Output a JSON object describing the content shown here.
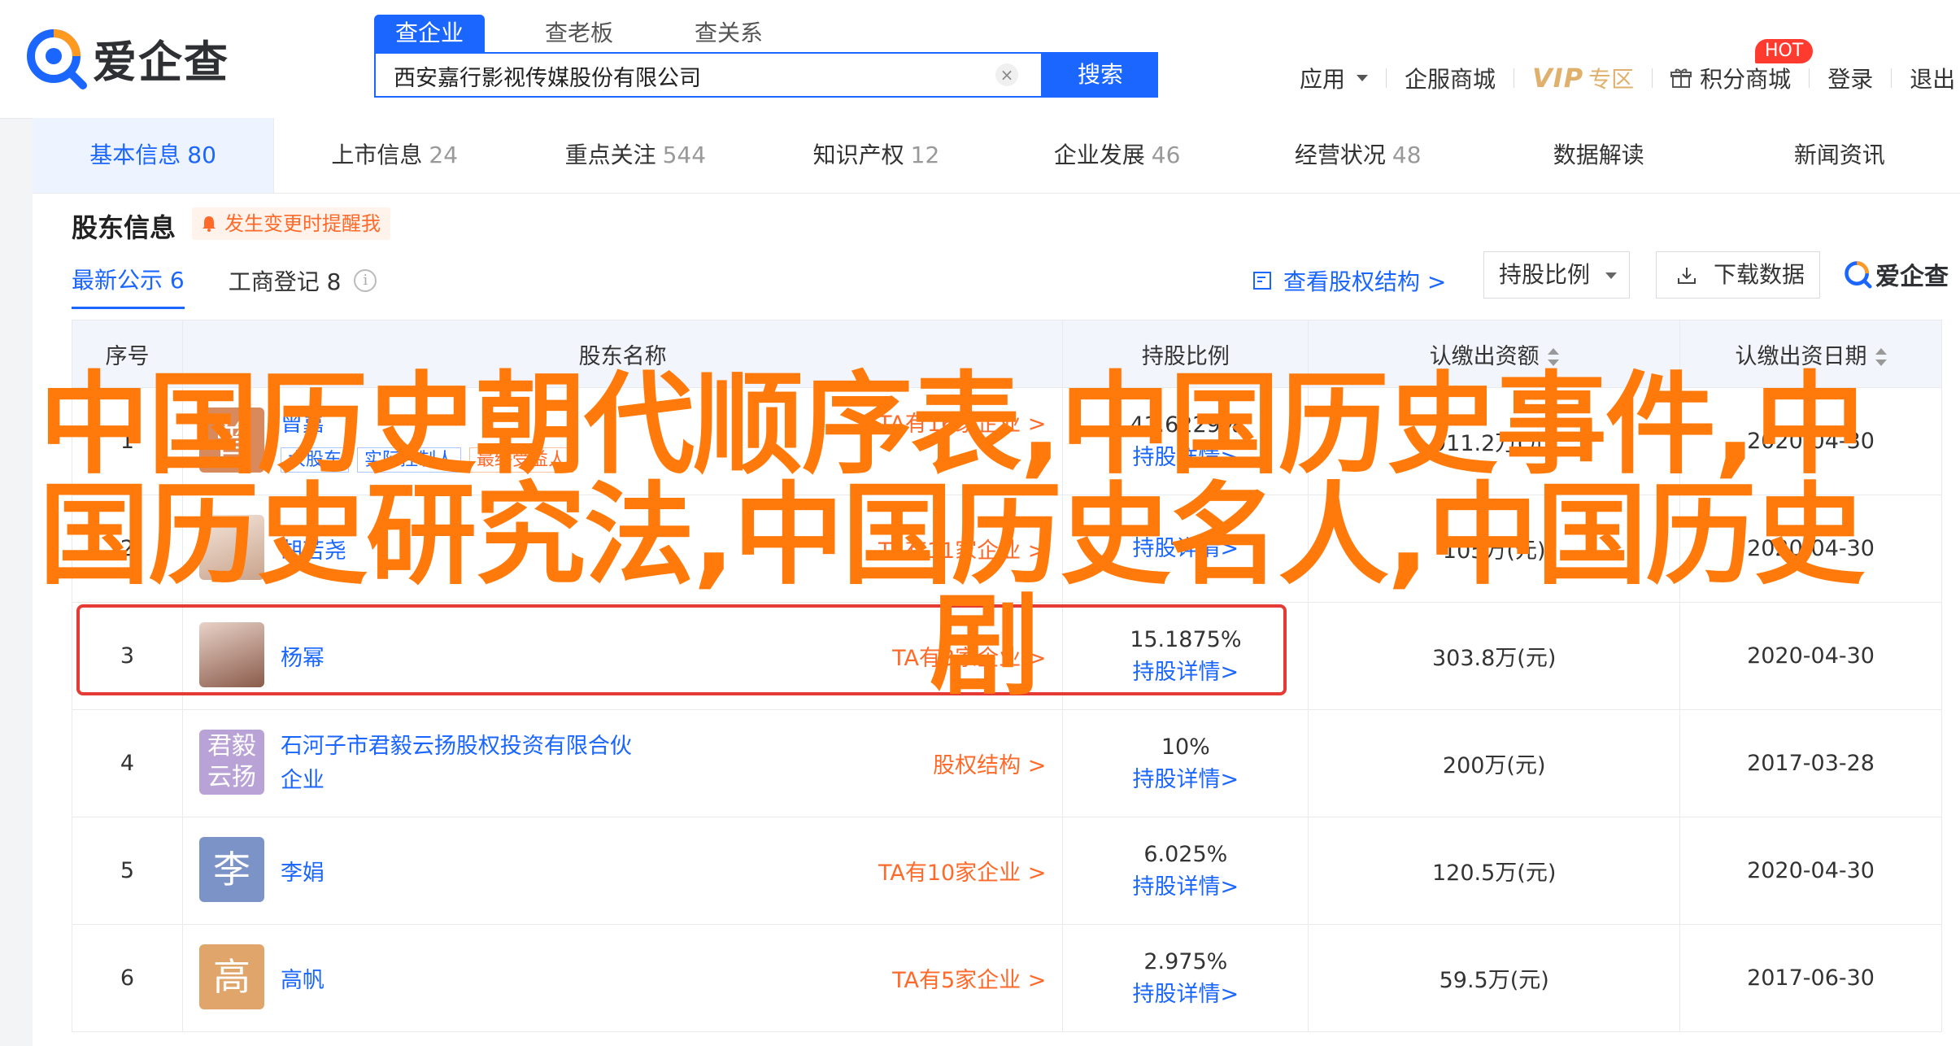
{
  "brand": {
    "name": "爱企查"
  },
  "search": {
    "tabs": [
      "查企业",
      "查老板",
      "查关系"
    ],
    "query": "西安嘉行影视传媒股份有限公司",
    "clear": "×",
    "button": "搜索"
  },
  "topnav": {
    "app": "应用",
    "service_mall": "企服商城",
    "vip": "VIP",
    "vip_zone": "专区",
    "points_mall": "积分商城",
    "hot": "HOT",
    "more": "登录",
    "exit": "退出"
  },
  "main_tabs": [
    {
      "label": "基本信息",
      "count": "80"
    },
    {
      "label": "上市信息",
      "count": "24"
    },
    {
      "label": "重点关注",
      "count": "544"
    },
    {
      "label": "知识产权",
      "count": "12"
    },
    {
      "label": "企业发展",
      "count": "46"
    },
    {
      "label": "经营状况",
      "count": "48"
    },
    {
      "label": "数据解读",
      "count": ""
    },
    {
      "label": "新闻资讯",
      "count": ""
    }
  ],
  "section": {
    "title": "股东信息",
    "notify": "发生变更时提醒我",
    "subtabs": [
      "最新公示 6",
      "工商登记 8"
    ],
    "equity_link": "查看股权结构 >",
    "ratio_dropdown": "持股比例",
    "download": "下载数据",
    "watermark": "爱企查"
  },
  "table": {
    "headers": [
      "序号",
      "股东名称",
      "持股比例",
      "认缴出资额",
      "认缴出资日期"
    ],
    "rows": [
      {
        "no": "1",
        "avatar": "曾",
        "name": "曾嘉",
        "tags": [
          "大股东",
          "实际控制人",
          "最终受益人"
        ],
        "link": "TA有16家企业 >",
        "pct": "41.6229%",
        "detail": "持股详情>",
        "amount": "911.2万(元)",
        "date": "2020-04-30"
      },
      {
        "no": "2",
        "avatar": "",
        "name": "胡若尧",
        "tags": [],
        "link": "TA有11家企业 >",
        "pct": "",
        "detail": "持股详情>",
        "amount": "105万(元)",
        "date": "2020-04-30"
      },
      {
        "no": "3",
        "avatar": "",
        "name": "杨幂",
        "tags": [],
        "link": "TA有3家企业 >",
        "pct": "15.1875%",
        "detail": "持股详情>",
        "amount": "303.8万(元)",
        "date": "2020-04-30"
      },
      {
        "no": "4",
        "avatar": "君毅云扬",
        "name": "石河子市君毅云扬股权投资有限合伙企业",
        "tags": [],
        "link": "股权结构 >",
        "pct": "10%",
        "detail": "持股详情>",
        "amount": "200万(元)",
        "date": "2017-03-28"
      },
      {
        "no": "5",
        "avatar": "李",
        "name": "李娟",
        "tags": [],
        "link": "TA有10家企业 >",
        "pct": "6.025%",
        "detail": "持股详情>",
        "amount": "120.5万(元)",
        "date": "2020-04-30"
      },
      {
        "no": "6",
        "avatar": "高",
        "name": "高帆",
        "tags": [],
        "link": "TA有5家企业 >",
        "pct": "2.975%",
        "detail": "持股详情>",
        "amount": "59.5万(元)",
        "date": "2017-06-30"
      }
    ]
  },
  "overlay": {
    "line1": "中国历史朝代顺序表,中国历史事件,中",
    "line2": "国历史研究法,中国历史名人,中国历史",
    "line3": "剧"
  },
  "colors": {
    "accent": "#1a66ff",
    "orange": "#ff6a2a",
    "overlay": "#ff7a0a",
    "highlight": "#e63b35"
  }
}
